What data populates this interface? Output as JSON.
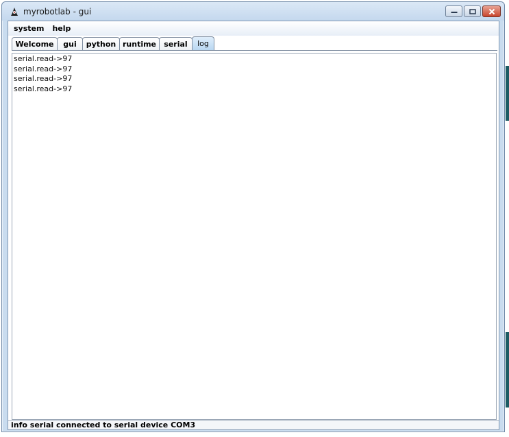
{
  "window": {
    "title": "myrobotlab - gui",
    "app_icon": "duke-icon",
    "controls": [
      "minimize-icon",
      "maximize-icon",
      "close-icon"
    ]
  },
  "menubar": {
    "items": [
      {
        "label": "system"
      },
      {
        "label": "help"
      }
    ]
  },
  "tabs": [
    {
      "label": "Welcome",
      "active": false
    },
    {
      "label": "gui",
      "active": false
    },
    {
      "label": "python",
      "active": false
    },
    {
      "label": "runtime",
      "active": false
    },
    {
      "label": "serial",
      "active": false
    },
    {
      "label": "log",
      "active": true
    }
  ],
  "log": {
    "lines": [
      "serial.read->97",
      "serial.read->97",
      "serial.read->97",
      "serial.read->97"
    ]
  },
  "status": {
    "text": "info serial connected to serial device COM3"
  },
  "colors": {
    "titlebar": "#c9dcef",
    "active_tab": "#b9d7f1",
    "close_button": "#c8452d",
    "desktop_strip": "#1d5b63"
  }
}
